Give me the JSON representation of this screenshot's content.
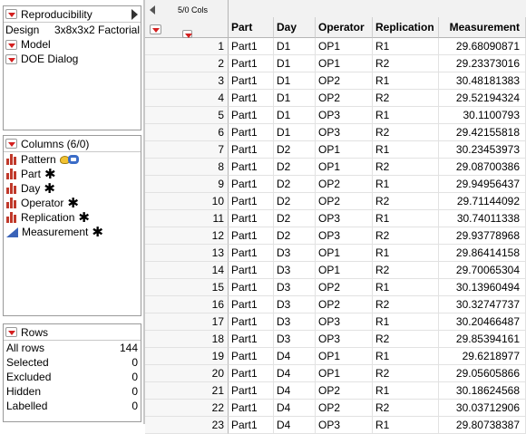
{
  "table_panel": {
    "title": "Reproducibility",
    "design_label": "Design",
    "design_value": "3x8x3x2 Factorial",
    "scripts": [
      "Model",
      "DOE Dialog"
    ]
  },
  "columns_panel": {
    "title": "Columns (6/0)",
    "items": [
      {
        "name": "Pattern",
        "icon": "bar-chart-icon",
        "marker": "pattern"
      },
      {
        "name": "Part",
        "icon": "bar-chart-icon",
        "marker": "star"
      },
      {
        "name": "Day",
        "icon": "bar-chart-icon",
        "marker": "star"
      },
      {
        "name": "Operator",
        "icon": "bar-chart-icon",
        "marker": "star"
      },
      {
        "name": "Replication",
        "icon": "bar-chart-icon",
        "marker": "star"
      },
      {
        "name": "Measurement",
        "icon": "continuous-triangle-icon",
        "marker": "star"
      }
    ],
    "star_glyph": "✱"
  },
  "rows_panel": {
    "title": "Rows",
    "stats": [
      {
        "label": "All rows",
        "value": "144"
      },
      {
        "label": "Selected",
        "value": "0"
      },
      {
        "label": "Excluded",
        "value": "0"
      },
      {
        "label": "Hidden",
        "value": "0"
      },
      {
        "label": "Labelled",
        "value": "0"
      }
    ]
  },
  "grid": {
    "cols_count": "5/0 Cols",
    "headers": [
      "Part",
      "Day",
      "Operator",
      "Replication",
      "Measurement"
    ],
    "rows": [
      [
        "1",
        "Part1",
        "D1",
        "OP1",
        "R1",
        "29.68090871"
      ],
      [
        "2",
        "Part1",
        "D1",
        "OP1",
        "R2",
        "29.23373016"
      ],
      [
        "3",
        "Part1",
        "D1",
        "OP2",
        "R1",
        "30.48181383"
      ],
      [
        "4",
        "Part1",
        "D1",
        "OP2",
        "R2",
        "29.52194324"
      ],
      [
        "5",
        "Part1",
        "D1",
        "OP3",
        "R1",
        "30.1100793"
      ],
      [
        "6",
        "Part1",
        "D1",
        "OP3",
        "R2",
        "29.42155818"
      ],
      [
        "7",
        "Part1",
        "D2",
        "OP1",
        "R1",
        "30.23453973"
      ],
      [
        "8",
        "Part1",
        "D2",
        "OP1",
        "R2",
        "29.08700386"
      ],
      [
        "9",
        "Part1",
        "D2",
        "OP2",
        "R1",
        "29.94956437"
      ],
      [
        "10",
        "Part1",
        "D2",
        "OP2",
        "R2",
        "29.71144092"
      ],
      [
        "11",
        "Part1",
        "D2",
        "OP3",
        "R1",
        "30.74011338"
      ],
      [
        "12",
        "Part1",
        "D2",
        "OP3",
        "R2",
        "29.93778968"
      ],
      [
        "13",
        "Part1",
        "D3",
        "OP1",
        "R1",
        "29.86414158"
      ],
      [
        "14",
        "Part1",
        "D3",
        "OP1",
        "R2",
        "29.70065304"
      ],
      [
        "15",
        "Part1",
        "D3",
        "OP2",
        "R1",
        "30.13960494"
      ],
      [
        "16",
        "Part1",
        "D3",
        "OP2",
        "R2",
        "30.32747737"
      ],
      [
        "17",
        "Part1",
        "D3",
        "OP3",
        "R1",
        "30.20466487"
      ],
      [
        "18",
        "Part1",
        "D3",
        "OP3",
        "R2",
        "29.85394161"
      ],
      [
        "19",
        "Part1",
        "D4",
        "OP1",
        "R1",
        "29.6218977"
      ],
      [
        "20",
        "Part1",
        "D4",
        "OP1",
        "R2",
        "29.05605866"
      ],
      [
        "21",
        "Part1",
        "D4",
        "OP2",
        "R1",
        "30.18624568"
      ],
      [
        "22",
        "Part1",
        "D4",
        "OP2",
        "R2",
        "30.03712906"
      ],
      [
        "23",
        "Part1",
        "D4",
        "OP3",
        "R1",
        "29.80738387"
      ]
    ]
  }
}
